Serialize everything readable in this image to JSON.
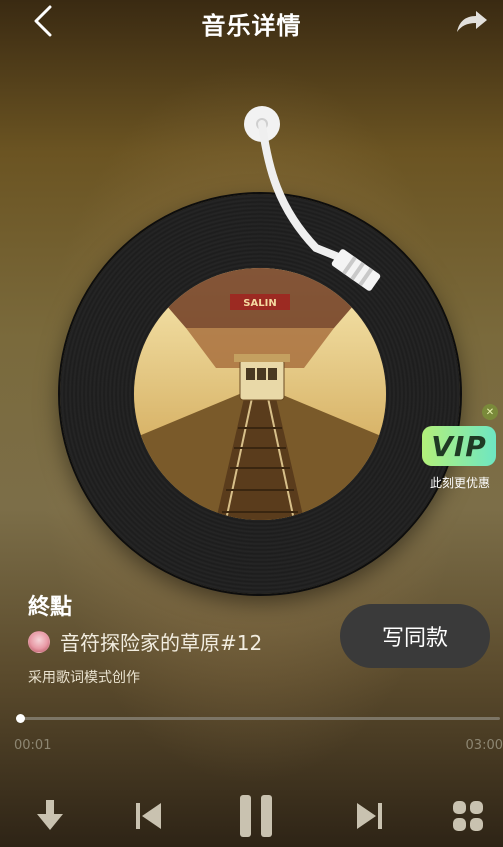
{
  "header": {
    "title": "音乐详情",
    "back_icon": "chevron-left-icon",
    "share_icon": "share-arrow-icon"
  },
  "song": {
    "title": "終點",
    "artist": "音符探险家的草原#12",
    "mode_note": "采用歌词模式创作"
  },
  "actions": {
    "write_same": "写同款"
  },
  "vip_promo": {
    "badge_text": "VIP",
    "caption": "此刻更优惠",
    "close_icon": "close-icon"
  },
  "cover_art": {
    "sign_text": "SALIN"
  },
  "player": {
    "current_time": "00:01",
    "total_time": "03:00",
    "progress": 0.0
  },
  "controls": {
    "download_icon": "download-icon",
    "prev_icon": "previous-track-icon",
    "pause_icon": "pause-icon",
    "next_icon": "next-track-icon",
    "more_icon": "grid-menu-icon"
  },
  "colors": {
    "primary_text": "#ffffff",
    "button_bg": "#3a3a3a",
    "vip_gradient_start": "#b3f07a",
    "vip_gradient_end": "#6ee6c2"
  }
}
